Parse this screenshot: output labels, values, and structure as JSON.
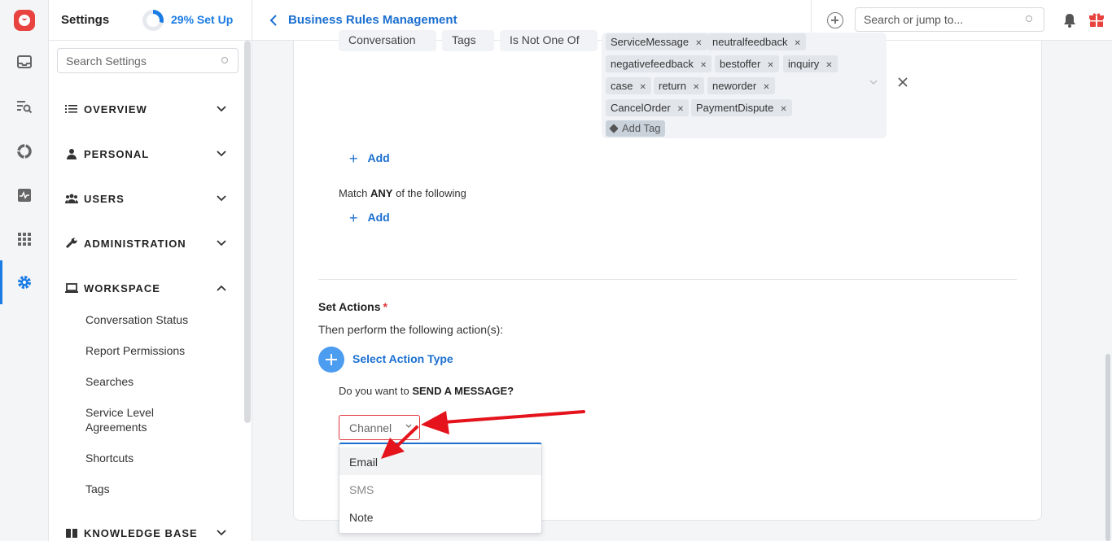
{
  "sidebar": {
    "title": "Settings",
    "setup_progress_label": "29% Set Up",
    "setup_progress": 0.29,
    "search_placeholder": "Search Settings",
    "groups": [
      {
        "label": "OVERVIEW",
        "icon": "list-icon",
        "expanded": false
      },
      {
        "label": "PERSONAL",
        "icon": "person-icon",
        "expanded": false
      },
      {
        "label": "USERS",
        "icon": "users-icon",
        "expanded": false
      },
      {
        "label": "ADMINISTRATION",
        "icon": "wrench-icon",
        "expanded": false
      },
      {
        "label": "WORKSPACE",
        "icon": "laptop-icon",
        "expanded": true
      },
      {
        "label": "KNOWLEDGE BASE",
        "icon": "book-icon",
        "expanded": false
      }
    ],
    "workspace_items": [
      "Conversation Status",
      "Report Permissions",
      "Searches",
      "Service Level Agreements",
      "Shortcuts",
      "Tags"
    ]
  },
  "topbar": {
    "page_title": "Business Rules Management",
    "search_placeholder": "Search or jump to..."
  },
  "condition": {
    "field": "Conversation",
    "attribute": "Tags",
    "operator": "Is Not One Of",
    "tags": [
      "ServiceMessage",
      "neutralfeedback",
      "negativefeedback",
      "bestoffer",
      "inquiry",
      "case",
      "return",
      "neworder",
      "CancelOrder",
      "PaymentDispute"
    ],
    "add_tag_label": "Add Tag"
  },
  "add_label": "Add",
  "match_prefix": "Match",
  "match_keyword": "ANY",
  "match_suffix": "of the following",
  "actions": {
    "heading": "Set Actions",
    "required_mark": "*",
    "subheading": "Then perform the following action(s):",
    "select_label": "Select Action Type",
    "question_prefix": "Do you want to",
    "question_keyword": "SEND A MESSAGE?",
    "channel_placeholder": "Channel",
    "channel_options": [
      "Email",
      "SMS",
      "Note"
    ]
  },
  "colors": {
    "accent": "#1b6fd0",
    "brand": "#e8433f",
    "error": "#e0333a"
  }
}
